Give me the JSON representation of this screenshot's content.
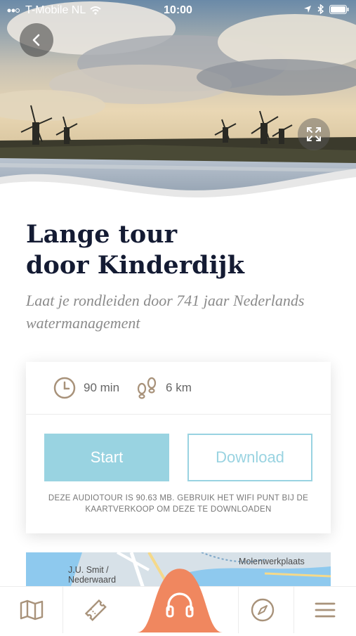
{
  "status_bar": {
    "carrier": "T-Mobile NL",
    "time": "10:00"
  },
  "hero": {
    "back_icon": "chevron-left-icon",
    "expand_icon": "expand-icon"
  },
  "tour": {
    "title_line1": "Lange tour",
    "title_line2": "door Kinderdijk",
    "subtitle": "Laat je rondleiden door 741 jaar Nederlands watermanagement"
  },
  "card": {
    "duration": "90 min",
    "distance": "6 km",
    "start_label": "Start",
    "download_label": "Download",
    "notice": "DEZE AUDIOTOUR IS 90.63 MB. GEBRUIK HET WIFI PUNT BIJ DE KAARTVERKOOP OM DEZE TE DOWNLOADEN"
  },
  "map": {
    "label_1_line1": "J.U. Smit /",
    "label_1_line2": "Nederwaard",
    "label_2": "Molenwerkplaats"
  },
  "nav": {
    "items": [
      "map-icon",
      "ticket-icon",
      "headphones-icon",
      "compass-icon",
      "menu-icon"
    ]
  },
  "colors": {
    "accent_blue": "#99d3e1",
    "accent_orange": "#f0875f",
    "title_navy": "#141b33",
    "icon_tan": "#a8927a"
  }
}
